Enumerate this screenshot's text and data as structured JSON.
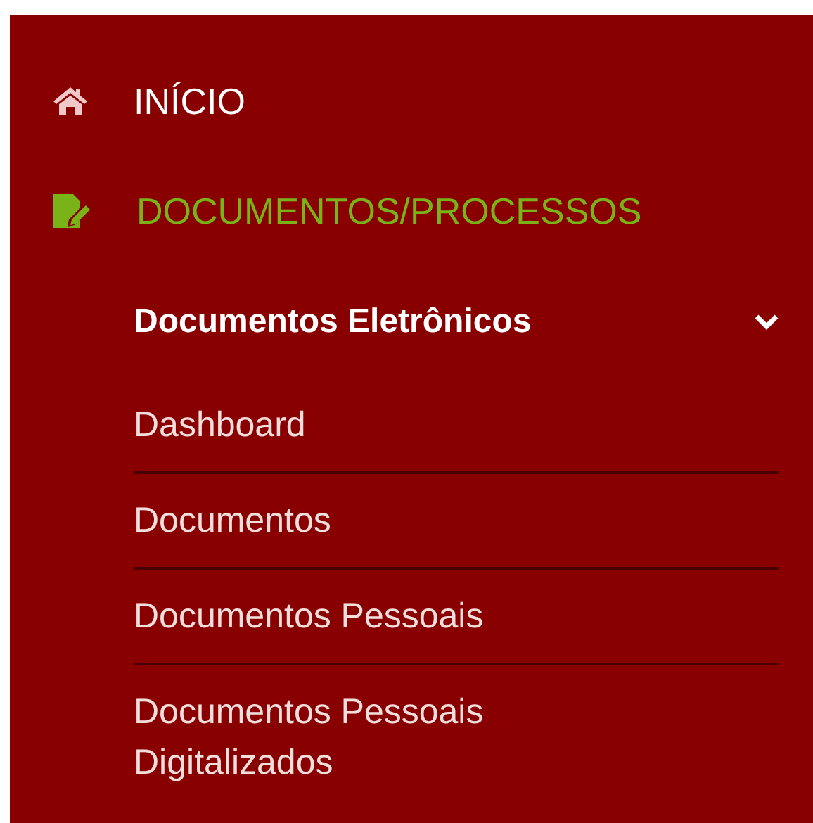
{
  "menu": [
    {
      "kind": "home",
      "label": "INÍCIO",
      "selected": false
    },
    {
      "kind": "document",
      "label": "DOCUMENTOS/PROCESSOS",
      "selected": true,
      "submenu": {
        "label": "Documentos Eletrônicos",
        "expanded": true,
        "items": [
          {
            "label": "Dashboard"
          },
          {
            "label": "Documentos"
          },
          {
            "label": "Documentos Pessoais"
          },
          {
            "label": "Documentos Pessoais Digitalizados"
          }
        ]
      }
    }
  ]
}
